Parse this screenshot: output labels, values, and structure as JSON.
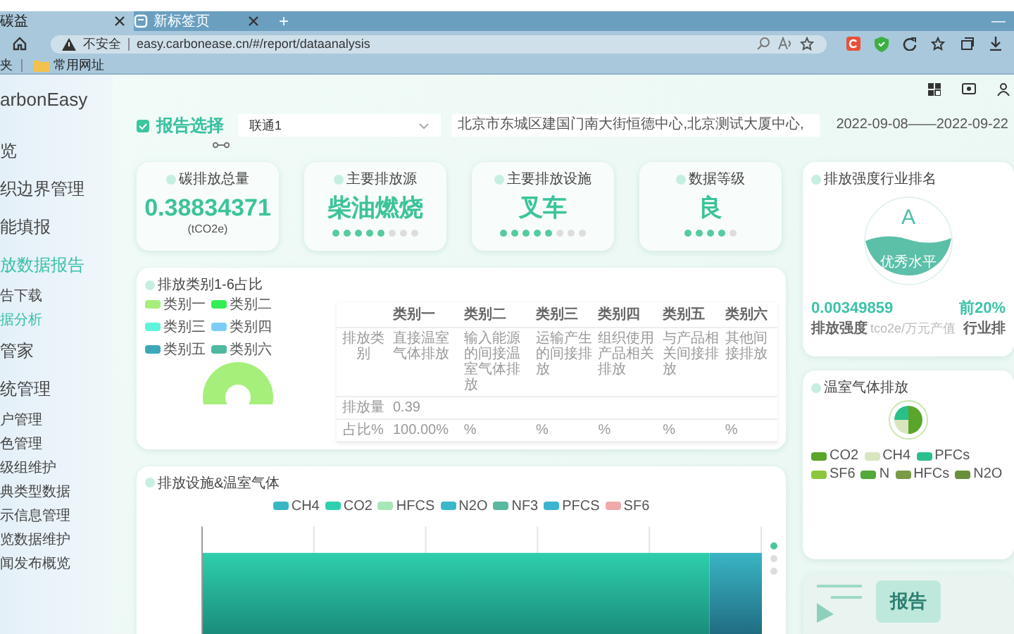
{
  "browser": {
    "tabs": [
      {
        "label": "碳益",
        "selected": true
      },
      {
        "label": "新标签页",
        "selected": false
      }
    ],
    "new_tab": "+",
    "minimize": "—",
    "security": "不安全",
    "url": "easy.carbonease.cn/#/report/dataanalysis",
    "bookmark_cut": "夹",
    "bookmark": "常用网址"
  },
  "sidebar": {
    "logo": "arbonEasy",
    "items": [
      {
        "label": "览",
        "selected": false
      },
      {
        "label": "织边界管理",
        "selected": false
      },
      {
        "label": "能填报",
        "selected": false
      },
      {
        "label": "放数据报告",
        "selected": true,
        "children": [
          {
            "label": "告下载",
            "selected": false
          },
          {
            "label": "据分析",
            "selected": true
          }
        ]
      },
      {
        "label": "管家",
        "selected": false
      },
      {
        "label": "统管理",
        "selected": false,
        "children": [
          {
            "label": "户管理",
            "selected": false
          },
          {
            "label": "色管理",
            "selected": false
          },
          {
            "label": "级组维护",
            "selected": false
          },
          {
            "label": "典类型数据",
            "selected": false
          },
          {
            "label": "示信息管理",
            "selected": false
          },
          {
            "label": "览数据维护",
            "selected": false
          },
          {
            "label": "闻发布概览",
            "selected": false
          }
        ]
      }
    ]
  },
  "report_bar": {
    "title": "报告选择",
    "company": "联通1",
    "address": "北京市东城区建国门南大街恒德中心,北京测试大厦中心,",
    "date_range": "2022-09-08——2022-09-22"
  },
  "stats": [
    {
      "label": "碳排放总量",
      "value": "0.38834371",
      "unit": "(tCO2e)"
    },
    {
      "label": "主要排放源",
      "value": "柴油燃烧",
      "dots": [
        {
          "filled": true
        },
        {
          "filled": true
        },
        {
          "filled": true
        },
        {
          "filled": true
        },
        {
          "filled": true
        },
        {
          "filled": false
        },
        {
          "filled": false
        },
        {
          "filled": false
        }
      ]
    },
    {
      "label": "主要排放设施",
      "value": "叉车",
      "dots": [
        {
          "filled": true
        },
        {
          "filled": true
        },
        {
          "filled": true
        },
        {
          "filled": true
        },
        {
          "filled": true
        },
        {
          "filled": false
        },
        {
          "filled": false
        },
        {
          "filled": false
        }
      ]
    },
    {
      "label": "数据等级",
      "value": "良",
      "dots": [
        {
          "filled": true
        },
        {
          "filled": true
        },
        {
          "filled": true
        },
        {
          "filled": true
        },
        {
          "filled": false
        }
      ]
    }
  ],
  "category_share": {
    "title": "排放类别1-6占比",
    "legend": [
      {
        "label": "类别一",
        "color": "#a6ef7a"
      },
      {
        "label": "类别二",
        "color": "#33ee55"
      },
      {
        "label": "类别三",
        "color": "#5ef5dc"
      },
      {
        "label": "类别四",
        "color": "#7ccdf5"
      },
      {
        "label": "类别五",
        "color": "#3aa8b8"
      },
      {
        "label": "类别六",
        "color": "#4fb8a0"
      }
    ],
    "table": {
      "columns": [
        "类别一",
        "类别二",
        "类别三",
        "类别四",
        "类别五",
        "类别六"
      ],
      "rows": [
        {
          "label": "排放类别",
          "cells": [
            "直接温室气体排放",
            "输入能源的间接温室气体排放",
            "运输产生的间接排放",
            "组织使用产品相关排放",
            "与产品相关间接排放",
            "其他间接排放"
          ]
        },
        {
          "label": "排放量",
          "cells": [
            "0.39"
          ]
        },
        {
          "label": "占比%",
          "cells": [
            "100.00%",
            "%",
            "%",
            "%",
            "%",
            "%"
          ]
        }
      ]
    }
  },
  "facility_gas": {
    "title": "排放设施&温室气体",
    "legend": [
      {
        "label": "CH4",
        "color": "#3ab5c4"
      },
      {
        "label": "CO2",
        "color": "#2ecfad"
      },
      {
        "label": "HFCS",
        "color": "#a8e6b8"
      },
      {
        "label": "N2O",
        "color": "#3ab8c8"
      },
      {
        "label": "NF3",
        "color": "#5bb8a0"
      },
      {
        "label": "PFCS",
        "color": "#3ab5d0"
      },
      {
        "label": "SF6",
        "color": "#f0aaa8"
      }
    ],
    "pager": [
      {
        "selected": true
      },
      {
        "selected": false
      },
      {
        "selected": false
      }
    ]
  },
  "ranking": {
    "title": "排放强度行业排名",
    "grade": "A",
    "grade_label": "优秀水平",
    "intensity": "0.00349859",
    "intensity_label": "排放强度",
    "intensity_unit": "tco2e/万元产值",
    "rank": "前20%",
    "rank_label": "行业排"
  },
  "ghg": {
    "title": "温室气体排放",
    "legend": [
      {
        "label": "CO2",
        "color": "#5aa52a"
      },
      {
        "label": "CH4",
        "color": "#d8e6c0"
      },
      {
        "label": "PFCs",
        "color": "#2bbf8a"
      },
      {
        "label": "SF6",
        "color": "#8cc63f"
      },
      {
        "label": "N",
        "color": "#52a838"
      },
      {
        "label": "HFCs",
        "color": "#7a9a45"
      },
      {
        "label": "N2O",
        "color": "#6a8f3a"
      }
    ]
  },
  "report_card": {
    "label": "报告"
  }
}
